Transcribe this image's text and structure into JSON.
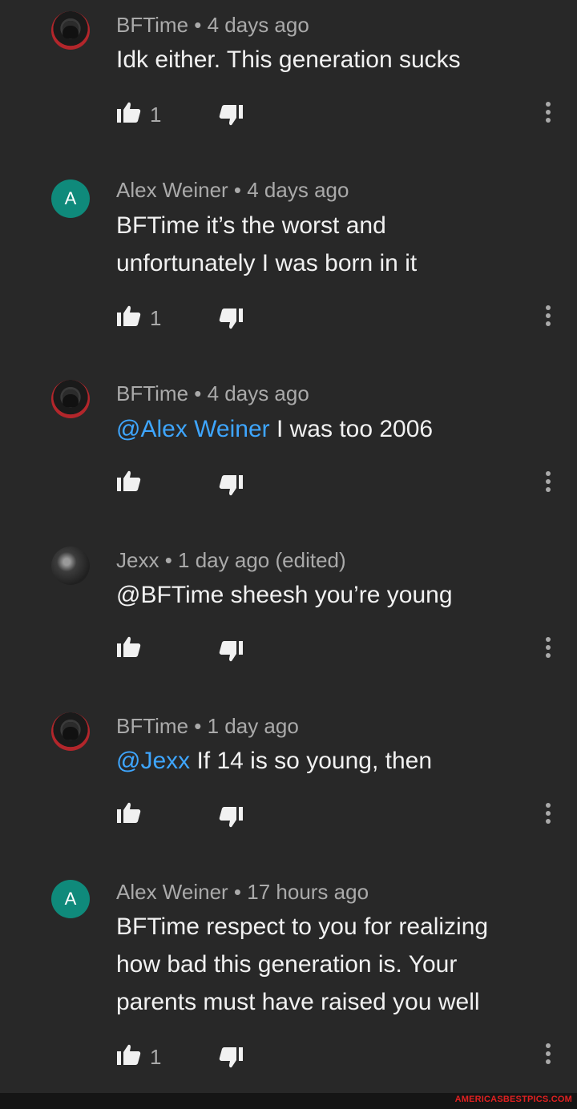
{
  "comments": [
    {
      "author": "BFTime",
      "time": "4 days ago",
      "edited": "",
      "mention": "",
      "text": "Idk either. This generation sucks",
      "likes": "1",
      "avatar": "helmet-avatar"
    },
    {
      "author": "Alex Weiner",
      "time": "4 days ago",
      "edited": "",
      "mention": "",
      "text": "BFTime it’s the worst and unfortunately I was born in it",
      "likes": "1",
      "avatar_letter": "A"
    },
    {
      "author": "BFTime",
      "time": "4 days ago",
      "edited": "",
      "mention": "@Alex Weiner",
      "text": " I was too 2006",
      "likes": "",
      "avatar": "helmet-avatar"
    },
    {
      "author": "Jexx",
      "time": "1 day ago",
      "edited": "(edited)",
      "mention": "",
      "text": "@BFTime sheesh you’re young",
      "likes": "",
      "avatar": "photo-avatar"
    },
    {
      "author": "BFTime",
      "time": "1 day ago",
      "edited": "",
      "mention": "@Jexx",
      "text": " If 14 is so young, then",
      "likes": "",
      "avatar": "helmet-avatar"
    },
    {
      "author": "Alex Weiner",
      "time": "17 hours ago",
      "edited": "",
      "mention": "",
      "text": "BFTime respect to you for realizing how bad this generation is. Your parents must have raised you well",
      "likes": "1",
      "avatar_letter": "A"
    }
  ],
  "separator": " • ",
  "watermark": "AMERICASBESTPICS.COM",
  "colors": {
    "background": "#282828",
    "mention": "#3ea6ff",
    "avatar_letter_bg": "#0f8a7b",
    "watermark": "#e02020"
  }
}
